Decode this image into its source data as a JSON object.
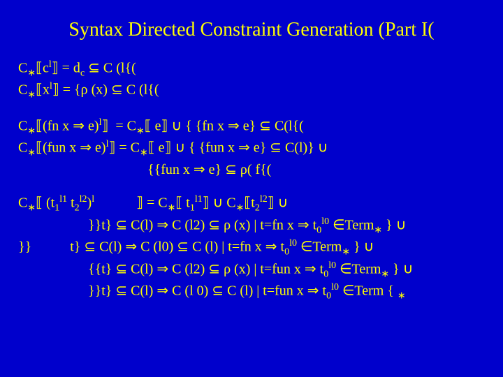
{
  "title": "Syntax Directed Constraint Generation (Part I(",
  "lines": {
    "l1": "C∗⟸cl⟶ = dc ⊆ C (l{(",
    "l2": "C∗⟸xl⟶ = {ρ (x) ⊆ C (l{(",
    "l3": "C∗⟸(fn x ⇒ e)l⟶  = C∗⟸ e⟶ ∪ { {fn x ⇒ e} ⊆ C(l{(",
    "l4": "C∗⟸(fun x ⇒ e)l⟶ = C∗⟸ e⟶ ∪ { {fun x ⇒ e} ⊆ C(l)} ∪",
    "l5": "{{fun x ⇒ e} ⊆ ρ( f{(",
    "l6": "C∗⟸ (t1l1 t2l2)l            ⟶ = C∗⟸ t1l1⟶ ∪ C∗⟸t2l2⟶ ∪",
    "l7": "}}t} ⊆ C(l) ⇒ C (l2) ⊆ ρ (x) | t=fn x ⇒ t0l0 ∈Term∗ } ∪",
    "l8": "}}         t} ⊆ C(l) ⇒ C (l0) ⊆ C (l) | t=fn x ⇒ t0l0 ∈Term∗ } ∪",
    "l9": "{{t} ⊆ C(l) ⇒ C (l2) ⊆ ρ (x) | t=fun x ⇒ t0l0 ∈Term∗ } ∪",
    "l10": "}}t} ⊆ C(l) ⇒ C (l 0) ⊆ C (l) | t=fun x ⇒ t0l0 ∈Term { ∗"
  }
}
